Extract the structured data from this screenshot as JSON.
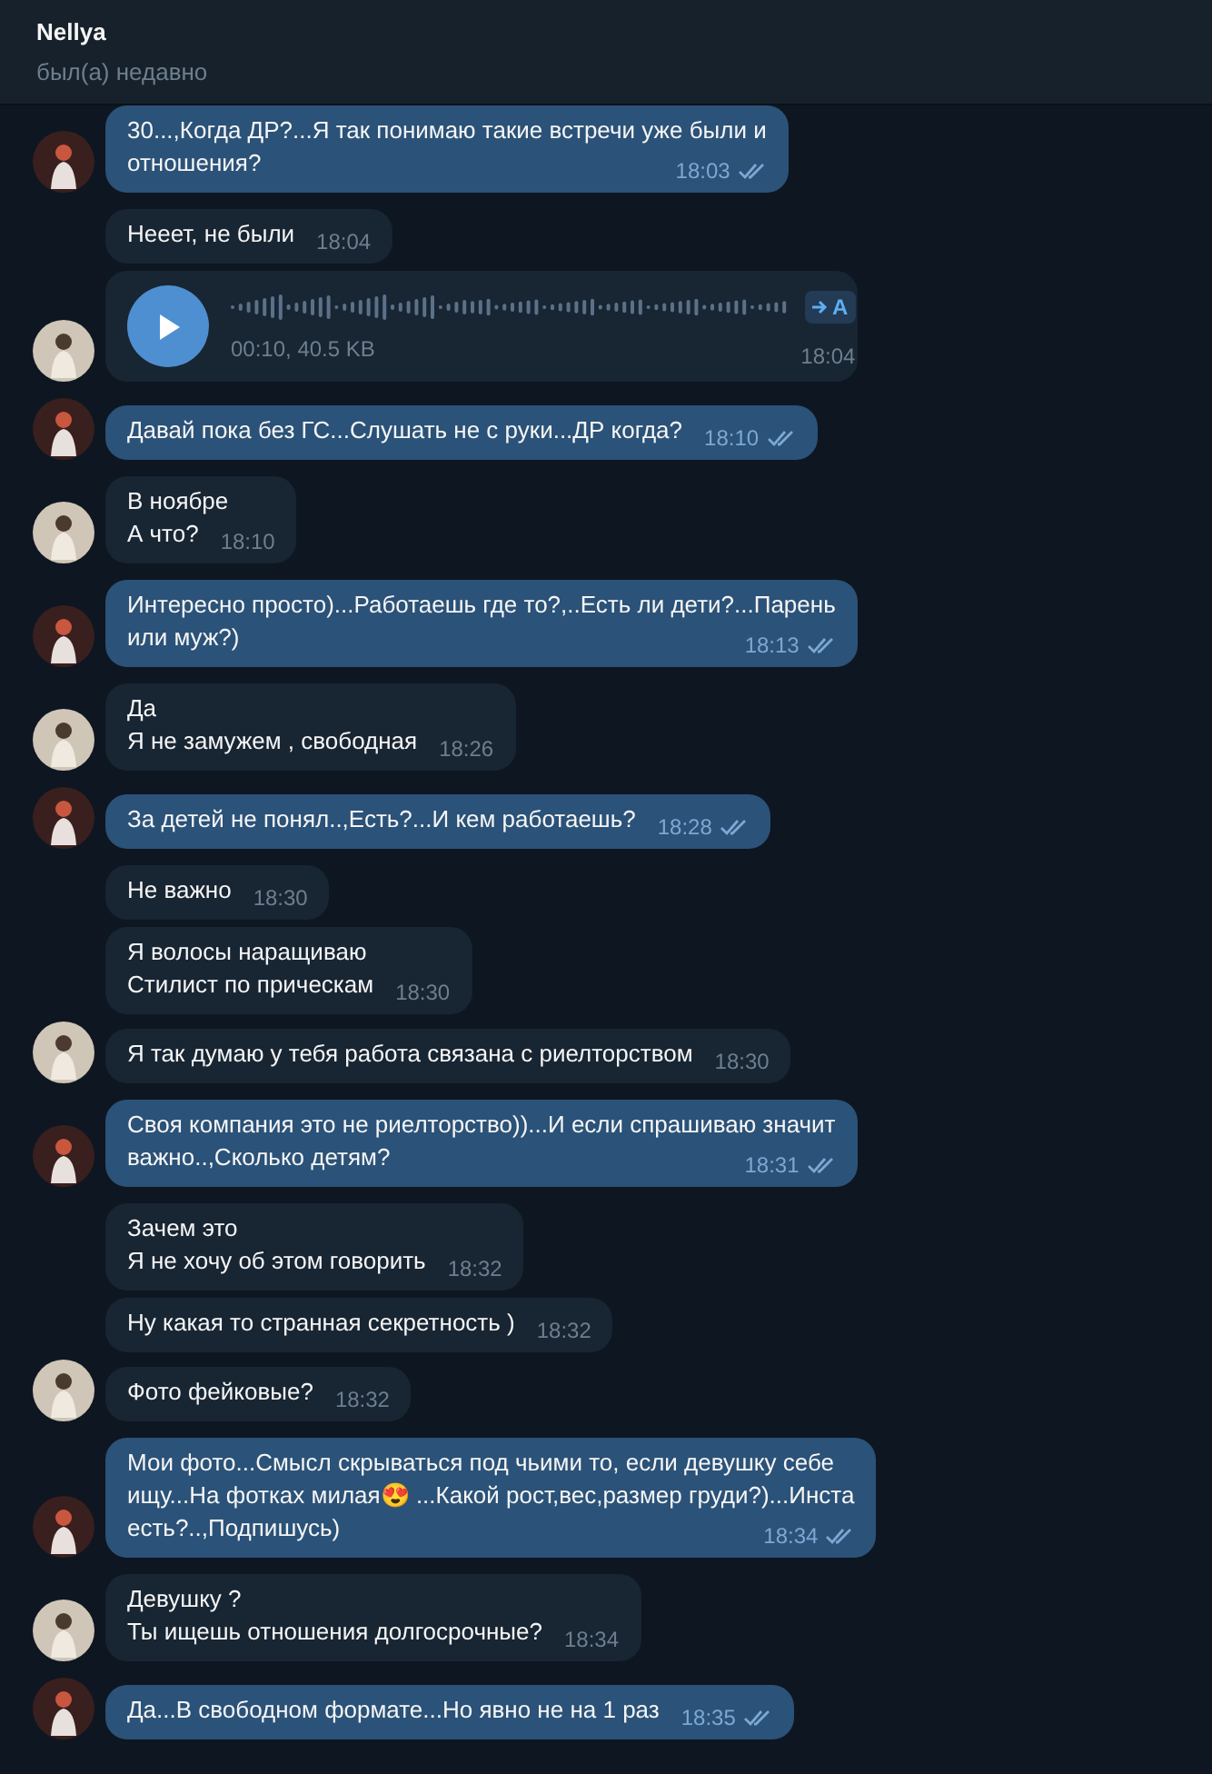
{
  "header": {
    "name": "Nellya",
    "status": "был(а) недавно"
  },
  "messages": [
    {
      "kind": "text",
      "outgoing": true,
      "lines": [
        "30...,Когда ДР?...Я так понимаю такие встречи уже были и",
        "отношения?"
      ],
      "time": "18:03",
      "read": true
    },
    {
      "kind": "text",
      "outgoing": false,
      "lines": [
        "Нееет, не были"
      ],
      "time": "18:04"
    },
    {
      "kind": "voice",
      "outgoing": false,
      "info": "00:10, 40.5 KB",
      "transcribe": "A",
      "time": "18:04"
    },
    {
      "kind": "text",
      "outgoing": true,
      "lines": [
        "Давай пока без ГС...Слушать не с руки...ДР когда?"
      ],
      "time": "18:10",
      "read": true
    },
    {
      "kind": "text",
      "outgoing": false,
      "lines": [
        "В ноябре",
        "А что?"
      ],
      "time": "18:10"
    },
    {
      "kind": "text",
      "outgoing": true,
      "lines": [
        "Интересно просто)...Работаешь где то?,..Есть ли дети?...Парень",
        "или муж?)"
      ],
      "time": "18:13",
      "read": true
    },
    {
      "kind": "text",
      "outgoing": false,
      "lines": [
        "Да",
        "Я не замужем , свободная"
      ],
      "time": "18:26"
    },
    {
      "kind": "text",
      "outgoing": true,
      "lines": [
        "За детей не понял..,Есть?...И кем работаешь?"
      ],
      "time": "18:28",
      "read": true
    },
    {
      "kind": "text",
      "outgoing": false,
      "lines": [
        "Не важно"
      ],
      "time": "18:30"
    },
    {
      "kind": "text",
      "outgoing": false,
      "lines": [
        "Я волосы наращиваю",
        "Стилист по прическам"
      ],
      "time": "18:30"
    },
    {
      "kind": "text",
      "outgoing": false,
      "lines": [
        "Я так думаю у тебя работа связана с риелторством"
      ],
      "time": "18:30"
    },
    {
      "kind": "text",
      "outgoing": true,
      "lines": [
        "Своя компания это не риелторство))...И если спрашиваю значит",
        "важно..,Сколько детям?"
      ],
      "time": "18:31",
      "read": true
    },
    {
      "kind": "text",
      "outgoing": false,
      "lines": [
        "Зачем это",
        "Я не хочу об этом говорить"
      ],
      "time": "18:32"
    },
    {
      "kind": "text",
      "outgoing": false,
      "lines": [
        "Ну какая то странная секретность )"
      ],
      "time": "18:32"
    },
    {
      "kind": "text",
      "outgoing": false,
      "lines": [
        "Фото фейковые?"
      ],
      "time": "18:32"
    },
    {
      "kind": "text",
      "outgoing": true,
      "lines": [
        "Мои фото...Смысл скрываться под чьими то, если девушку себе",
        "ищу...На фотках милая😍 ...Какой рост,вес,размер груди?)...Инста",
        "есть?..,Подпишусь)"
      ],
      "time": "18:34",
      "read": true
    },
    {
      "kind": "text",
      "outgoing": false,
      "lines": [
        "Девушку ?",
        "Ты ищешь отношения долгосрочные?"
      ],
      "time": "18:34"
    },
    {
      "kind": "text",
      "outgoing": true,
      "lines": [
        "Да...В свободном формате...Но явно не на 1 раз"
      ],
      "time": "18:35",
      "read": true
    }
  ]
}
